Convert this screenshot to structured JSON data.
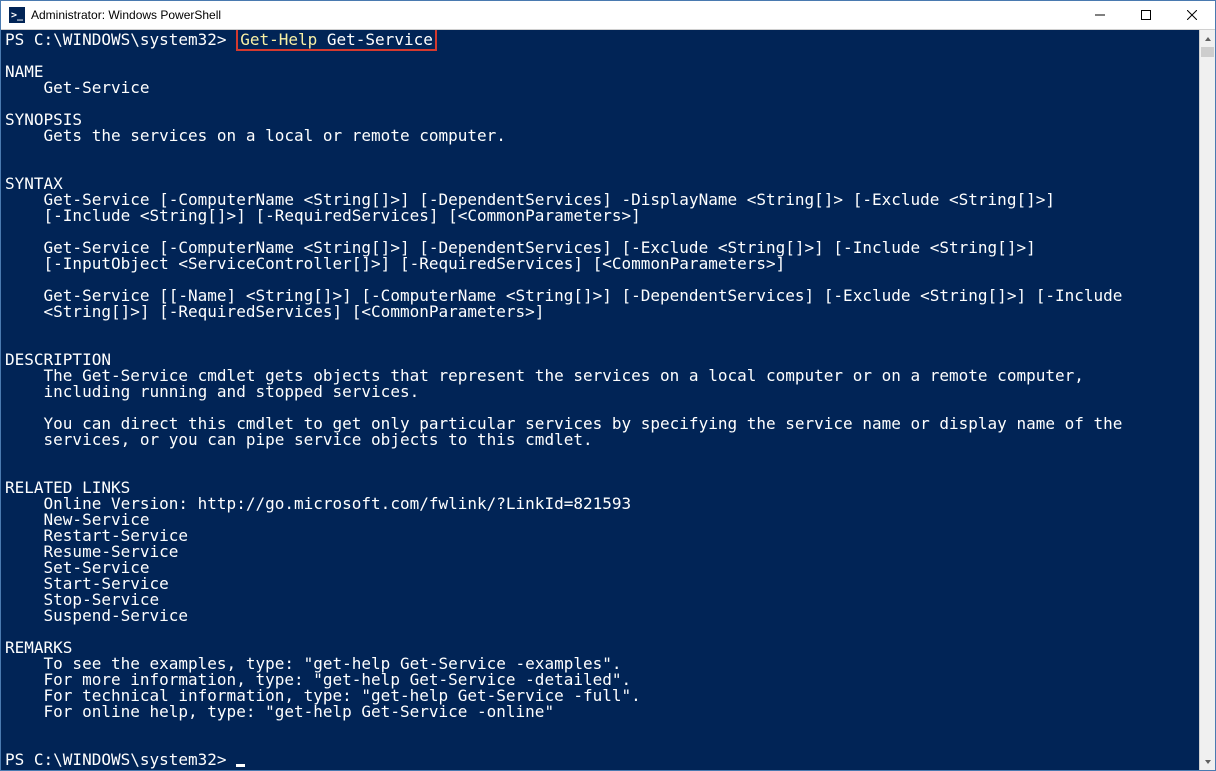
{
  "window": {
    "title": "Administrator: Windows PowerShell",
    "icon_glyph": ">_"
  },
  "prompt": "PS C:\\WINDOWS\\system32> ",
  "command": {
    "cmdlet": "Get-Help",
    "arg": " Get-Service"
  },
  "help": {
    "name_header": "NAME",
    "name_value": "    Get-Service",
    "synopsis_header": "SYNOPSIS",
    "synopsis_value": "    Gets the services on a local or remote computer.",
    "syntax_header": "SYNTAX",
    "syntax_1a": "    Get-Service [-ComputerName <String[]>] [-DependentServices] -DisplayName <String[]> [-Exclude <String[]>]",
    "syntax_1b": "    [-Include <String[]>] [-RequiredServices] [<CommonParameters>]",
    "syntax_2a": "    Get-Service [-ComputerName <String[]>] [-DependentServices] [-Exclude <String[]>] [-Include <String[]>]",
    "syntax_2b": "    [-InputObject <ServiceController[]>] [-RequiredServices] [<CommonParameters>]",
    "syntax_3a": "    Get-Service [[-Name] <String[]>] [-ComputerName <String[]>] [-DependentServices] [-Exclude <String[]>] [-Include",
    "syntax_3b": "    <String[]>] [-RequiredServices] [<CommonParameters>]",
    "description_header": "DESCRIPTION",
    "description_1": "    The Get-Service cmdlet gets objects that represent the services on a local computer or on a remote computer,",
    "description_2": "    including running and stopped services.",
    "description_3": "    You can direct this cmdlet to get only particular services by specifying the service name or display name of the",
    "description_4": "    services, or you can pipe service objects to this cmdlet.",
    "related_header": "RELATED LINKS",
    "related_links": [
      "    Online Version: http://go.microsoft.com/fwlink/?LinkId=821593",
      "    New-Service",
      "    Restart-Service",
      "    Resume-Service",
      "    Set-Service",
      "    Start-Service",
      "    Stop-Service",
      "    Suspend-Service"
    ],
    "remarks_header": "REMARKS",
    "remarks": [
      "    To see the examples, type: \"get-help Get-Service -examples\".",
      "    For more information, type: \"get-help Get-Service -detailed\".",
      "    For technical information, type: \"get-help Get-Service -full\".",
      "    For online help, type: \"get-help Get-Service -online\""
    ]
  },
  "colors": {
    "terminal_bg": "#012456",
    "terminal_fg": "#ffffff",
    "highlight_border": "#d43a2f",
    "cmdlet_color": "#f9f1a5"
  }
}
